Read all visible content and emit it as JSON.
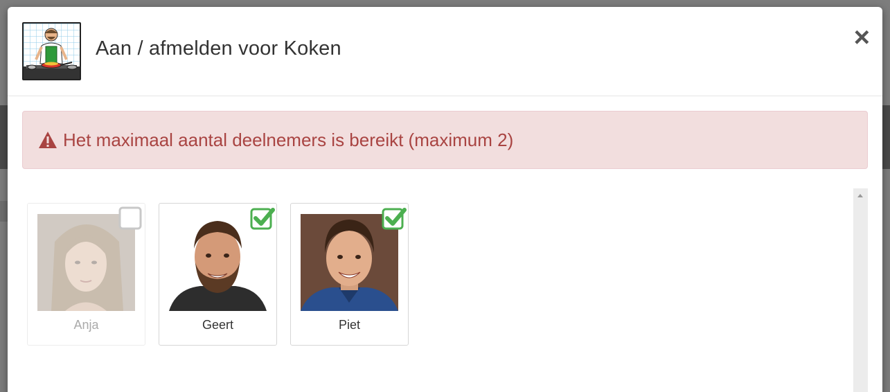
{
  "modal": {
    "title": "Aan / afmelden voor Koken",
    "activity_icon": "cooking-pictogram",
    "close_label": "×"
  },
  "alert": {
    "icon": "warning-triangle-icon",
    "message": "Het maximaal aantal deelnemers is bereikt (maximum 2)",
    "color": "#a94442",
    "background": "#f2dede"
  },
  "participants": [
    {
      "name": "Anja",
      "checked": false
    },
    {
      "name": "Geert",
      "checked": true
    },
    {
      "name": "Piet",
      "checked": true
    }
  ],
  "colors": {
    "check_green": "#4caf50"
  }
}
